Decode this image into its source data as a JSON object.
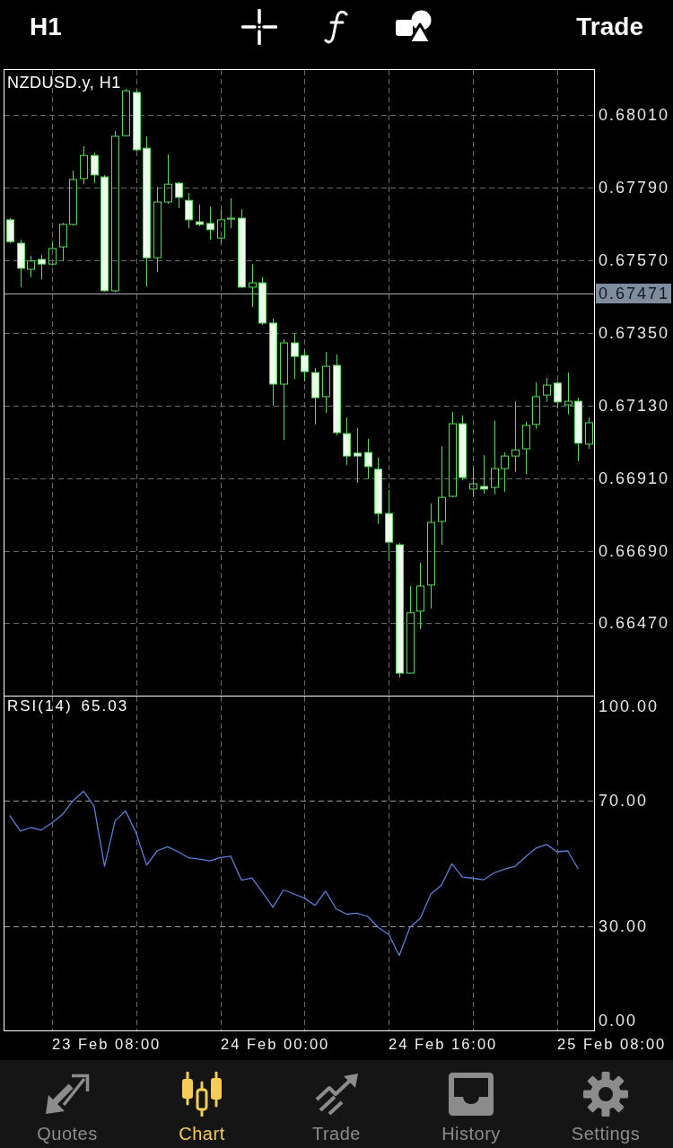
{
  "top_bar": {
    "timeframe": "H1",
    "trade_button": "Trade"
  },
  "price_chart": {
    "title": "NZDUSD.y, H1",
    "current_price": "0.67471",
    "chart_data": {
      "type": "candlestick",
      "grid": true,
      "categories": [
        null,
        null,
        null,
        null,
        null,
        null,
        null,
        null,
        null,
        null,
        null,
        null,
        null,
        null,
        null,
        null,
        null,
        null,
        null,
        null,
        null,
        null,
        null,
        null,
        null,
        null,
        null,
        null,
        null,
        null,
        null,
        null,
        null,
        null,
        null,
        null,
        null,
        null,
        null,
        null,
        null,
        null,
        null,
        null,
        null,
        null,
        null,
        null,
        null,
        null,
        null,
        null,
        null,
        null,
        null,
        null
      ],
      "ylim": [
        0.66251,
        0.68147
      ],
      "yticks": [
        {
          "value": 0.6801,
          "label": "0.68010"
        },
        {
          "value": 0.6779,
          "label": "0.67790"
        },
        {
          "value": 0.6757,
          "label": "0.67570"
        },
        {
          "value": 0.6735,
          "label": "0.67350"
        },
        {
          "value": 0.6713,
          "label": "0.67130"
        },
        {
          "value": 0.6691,
          "label": "0.66910"
        },
        {
          "value": 0.6669,
          "label": "0.66690"
        },
        {
          "value": 0.6647,
          "label": "0.66470"
        }
      ],
      "ref_lines": [
        {
          "axis": "y",
          "value": 0.67471
        }
      ],
      "ohlc": [
        [
          0.67693,
          0.67698,
          0.67622,
          0.67627
        ],
        [
          0.67622,
          0.67633,
          0.67489,
          0.67546
        ],
        [
          0.67543,
          0.67584,
          0.67519,
          0.67568
        ],
        [
          0.67573,
          0.67587,
          0.67513,
          0.67559
        ],
        [
          0.67559,
          0.67625,
          0.67554,
          0.67606
        ],
        [
          0.67611,
          0.67684,
          0.67568,
          0.67679
        ],
        [
          0.67679,
          0.67842,
          0.67676,
          0.67815
        ],
        [
          0.67818,
          0.67916,
          0.67801,
          0.67888
        ],
        [
          0.67888,
          0.67897,
          0.67804,
          0.67829
        ],
        [
          0.67823,
          0.67829,
          0.67475,
          0.67478
        ],
        [
          0.67478,
          0.67962,
          0.67475,
          0.67946
        ],
        [
          0.67948,
          0.6809,
          0.67946,
          0.68084
        ],
        [
          0.68079,
          0.68087,
          0.67902,
          0.67905
        ],
        [
          0.6791,
          0.67946,
          0.67491,
          0.67578
        ],
        [
          0.67578,
          0.67793,
          0.67535,
          0.67747
        ],
        [
          0.67747,
          0.67891,
          0.67742,
          0.67801
        ],
        [
          0.67804,
          0.67807,
          0.67728,
          0.67761
        ],
        [
          0.67752,
          0.67774,
          0.67668,
          0.67693
        ],
        [
          0.67687,
          0.67739,
          0.67674,
          0.67679
        ],
        [
          0.67682,
          0.67733,
          0.67633,
          0.67663
        ],
        [
          0.67638,
          0.67725,
          0.67622,
          0.67693
        ],
        [
          0.67695,
          0.67758,
          0.67668,
          0.67698
        ],
        [
          0.67698,
          0.67725,
          0.67486,
          0.67489
        ],
        [
          0.67489,
          0.67559,
          0.67429,
          0.67502
        ],
        [
          0.67502,
          0.67519,
          0.67374,
          0.6738
        ],
        [
          0.6738,
          0.67394,
          0.6713,
          0.67195
        ],
        [
          0.67195,
          0.67331,
          0.67026,
          0.6732
        ],
        [
          0.6732,
          0.67347,
          0.67211,
          0.67279
        ],
        [
          0.67282,
          0.67298,
          0.67203,
          0.67233
        ],
        [
          0.6723,
          0.67244,
          0.67073,
          0.67154
        ],
        [
          0.67157,
          0.67293,
          0.67108,
          0.67249
        ],
        [
          0.67252,
          0.67285,
          0.6704,
          0.67048
        ],
        [
          0.67045,
          0.67094,
          0.6695,
          0.66977
        ],
        [
          0.66986,
          0.67062,
          0.66896,
          0.66977
        ],
        [
          0.66988,
          0.67029,
          0.66909,
          0.66945
        ],
        [
          0.66937,
          0.66972,
          0.66771,
          0.66803
        ],
        [
          0.66803,
          0.66874,
          0.66659,
          0.66716
        ],
        [
          0.66708,
          0.66714,
          0.66306,
          0.66319
        ],
        [
          0.66319,
          0.66583,
          0.66317,
          0.66502
        ],
        [
          0.66507,
          0.66654,
          0.66453,
          0.66583
        ],
        [
          0.66586,
          0.66833,
          0.66515,
          0.66776
        ],
        [
          0.66779,
          0.67007,
          0.66708,
          0.66852
        ],
        [
          0.66855,
          0.67111,
          0.66852,
          0.67075
        ],
        [
          0.67075,
          0.671,
          0.66904,
          0.66912
        ],
        [
          0.66877,
          0.66942,
          0.66855,
          0.66893
        ],
        [
          0.66885,
          0.6698,
          0.66863,
          0.66877
        ],
        [
          0.66882,
          0.67084,
          0.66861,
          0.66939
        ],
        [
          0.66939,
          0.66988,
          0.66869,
          0.66977
        ],
        [
          0.66977,
          0.67143,
          0.66929,
          0.66996
        ],
        [
          0.66999,
          0.67081,
          0.66923,
          0.6707
        ],
        [
          0.67073,
          0.672,
          0.67059,
          0.67157
        ],
        [
          0.67162,
          0.67214,
          0.67141,
          0.67192
        ],
        [
          0.67198,
          0.67203,
          0.67122,
          0.67141
        ],
        [
          0.67132,
          0.6723,
          0.67103,
          0.67143
        ],
        [
          0.67143,
          0.67154,
          0.66961,
          0.67016
        ],
        [
          0.67013,
          0.67094,
          0.66999,
          0.67078
        ]
      ]
    }
  },
  "rsi_chart": {
    "current_value": "65.03",
    "chart_data": {
      "type": "line",
      "grid": "x",
      "categories": [
        null,
        null,
        null,
        null,
        null,
        null,
        null,
        null,
        null,
        null,
        null,
        null,
        null,
        null,
        null,
        null,
        null,
        null,
        null,
        null,
        null,
        null,
        null,
        null,
        null,
        null,
        null,
        null,
        null,
        null,
        null,
        null,
        null,
        null,
        null,
        null,
        null,
        null,
        null,
        null,
        null,
        null,
        null,
        null,
        null,
        null,
        null,
        null,
        null,
        null,
        null,
        null,
        null,
        null,
        null,
        null
      ],
      "ylim": [
        -3,
        103
      ],
      "yticks": [
        {
          "value": 100,
          "label": "100.00"
        },
        {
          "value": 70,
          "label": "70.00"
        },
        {
          "value": 30,
          "label": "30.00"
        },
        {
          "value": 0,
          "label": "0.00"
        }
      ],
      "ref_lines": [
        {
          "axis": "y",
          "value": 70
        },
        {
          "axis": "y",
          "value": 30
        }
      ],
      "series": [
        {
          "name": "RSI(14)",
          "color": "#5b7fd6",
          "values": [
            65.2,
            60.3,
            61.4,
            60.6,
            62.9,
            65.5,
            69.9,
            72.9,
            68.3,
            49.1,
            63.5,
            66.7,
            59.7,
            49.5,
            54.0,
            55.3,
            53.7,
            51.8,
            51.4,
            50.8,
            51.9,
            52.3,
            44.7,
            45.4,
            40.9,
            36.1,
            41.6,
            40.3,
            39.0,
            36.7,
            41.2,
            35.6,
            33.9,
            34.2,
            33.2,
            29.7,
            27.5,
            20.8,
            29.7,
            32.6,
            40.3,
            43.1,
            49.9,
            45.7,
            45.3,
            44.8,
            47.0,
            48.2,
            49.1,
            52.1,
            54.9,
            56.0,
            53.7,
            54.0,
            48.2,
            null
          ]
        }
      ]
    }
  },
  "time_axis": [
    "23 Feb 08:00",
    "24 Feb 00:00",
    "24 Feb 16:00",
    "25 Feb 08:00"
  ],
  "nav_tabs": [
    {
      "label": "Quotes",
      "kind": "quotes",
      "selected": false
    },
    {
      "label": "Chart",
      "kind": "chart",
      "selected": true
    },
    {
      "label": "Trade",
      "kind": "trade",
      "selected": false
    },
    {
      "label": "History",
      "kind": "history",
      "selected": false
    },
    {
      "label": "Settings",
      "kind": "settings",
      "selected": false
    }
  ]
}
